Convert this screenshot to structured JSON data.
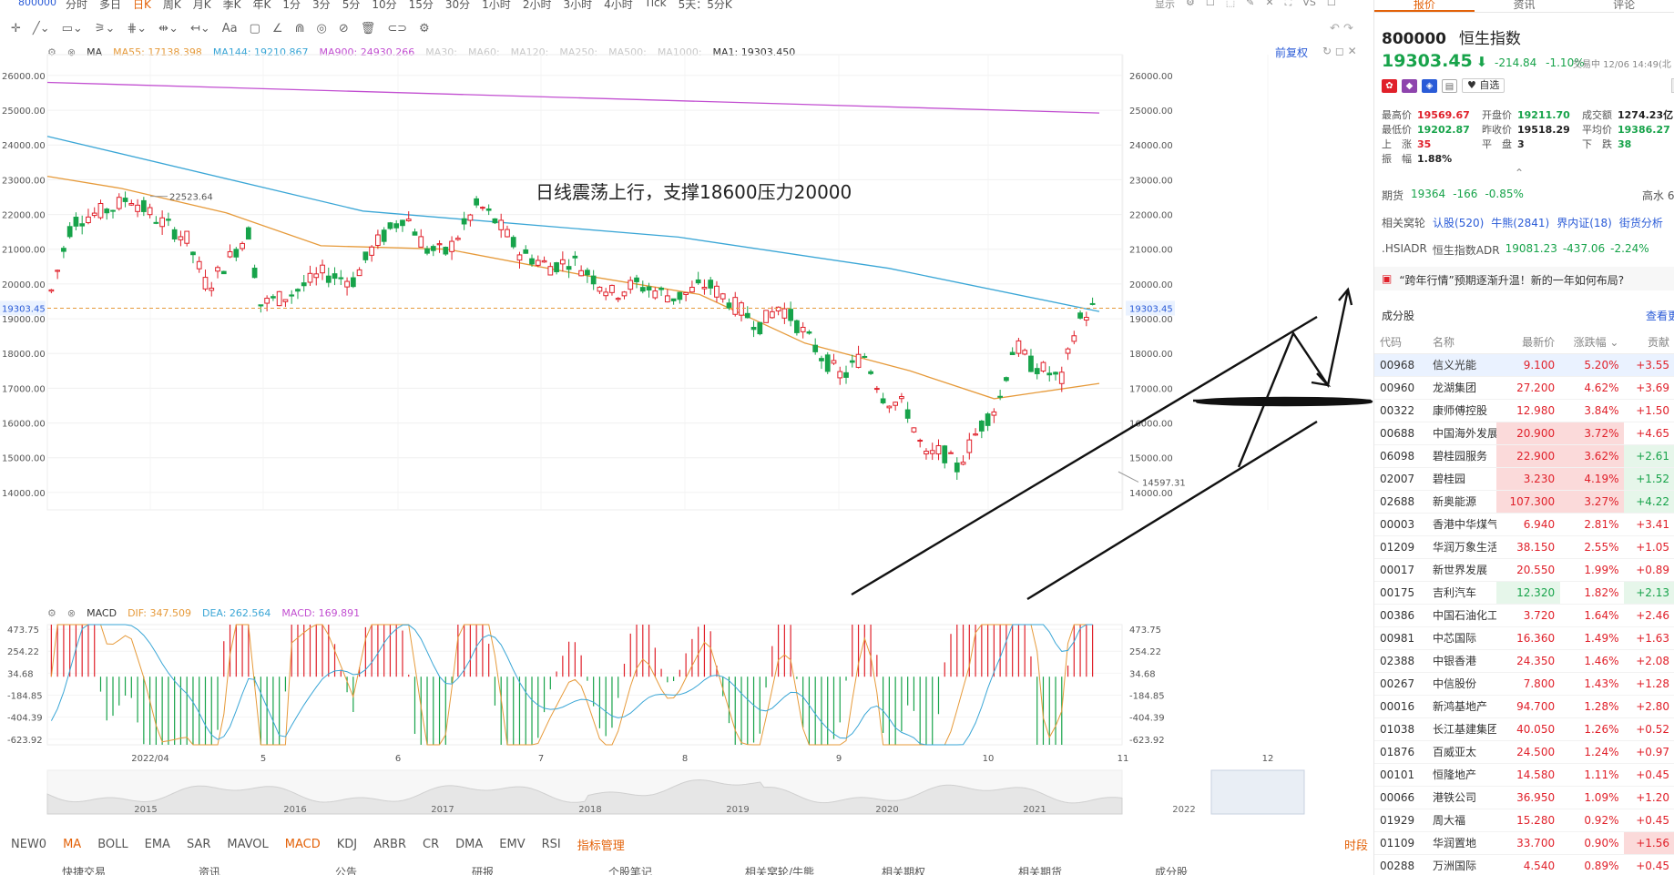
{
  "toolbar": {
    "code": "800000",
    "periods": [
      "分时",
      "多日",
      "日K",
      "周K",
      "月K",
      "季K",
      "年K",
      "1分",
      "3分",
      "5分",
      "10分",
      "15分",
      "30分",
      "1小时",
      "2小时",
      "3小时",
      "4小时",
      "Tick",
      "5天：5分K"
    ],
    "active_period": "日K",
    "right": [
      "显示",
      "⚙",
      "☐",
      "⬚",
      "✎",
      "✕",
      "⛶",
      "VS",
      "☐"
    ]
  },
  "legend_main": {
    "label": "MA",
    "ma55": "MA55: 17138.398",
    "ma144": "MA144: 19210.867",
    "ma900": "MA900: 24930.266",
    "inactive": [
      "MA30:",
      "MA60:",
      "MA120:",
      "MA250:",
      "MA500:",
      "MA1000:"
    ],
    "ma1": "MA1: 19303.450",
    "restore": "前复权"
  },
  "legend_macd": {
    "label": "MACD",
    "dif": "DIF: 347.509",
    "dea": "DEA: 262.564",
    "macd": "MACD: 169.891"
  },
  "colors": {
    "up": "#e0202a",
    "down": "#17a34a",
    "ma55": "#e69a3a",
    "ma144": "#3aa6d6",
    "ma900": "#c24fd1",
    "accent": "#e36209",
    "link": "#2a5bd7"
  },
  "chart_data": {
    "type": "candlestick",
    "title": "",
    "annotation": "日线震荡上行，支撑18600压力20000",
    "y_ticks": [
      "26000.00",
      "25000.00",
      "24000.00",
      "23000.00",
      "22000.00",
      "21000.00",
      "20000.00",
      "19000.00",
      "18000.00",
      "17000.00",
      "16000.00",
      "15000.00",
      "14000.00"
    ],
    "ylim": [
      13500,
      26600
    ],
    "current_price": "19303.45",
    "current_price_right": "19303.45",
    "high_label": "22523.64",
    "low_label": "14597.31",
    "x_labels": [
      "2022/04",
      "5",
      "6",
      "7",
      "8",
      "9",
      "10",
      "11",
      "12"
    ],
    "series": [
      {
        "name": "MA900",
        "points": [
          [
            0,
            25800
          ],
          [
            1,
            24920
          ]
        ]
      },
      {
        "name": "MA144",
        "points": [
          [
            0,
            24250
          ],
          [
            0.3,
            22100
          ],
          [
            0.6,
            21350
          ],
          [
            0.8,
            20450
          ],
          [
            1,
            19210
          ]
        ]
      },
      {
        "name": "MA55",
        "points": [
          [
            0,
            23100
          ],
          [
            0.07,
            22750
          ],
          [
            0.17,
            22050
          ],
          [
            0.26,
            21100
          ],
          [
            0.38,
            21000
          ],
          [
            0.52,
            20200
          ],
          [
            0.62,
            19700
          ],
          [
            0.72,
            18300
          ],
          [
            0.82,
            17500
          ],
          [
            0.9,
            16700
          ],
          [
            1,
            17140
          ]
        ]
      }
    ],
    "macd_ticks": [
      "473.75",
      "254.22",
      "34.68",
      "-184.85",
      "-404.39",
      "-623.92"
    ],
    "macd_ylim": [
      -680,
      520
    ],
    "macd_series": [
      {
        "name": "DIF",
        "color": "#e69a3a"
      },
      {
        "name": "DEA",
        "color": "#3aa6d6"
      }
    ]
  },
  "overview": {
    "years": [
      "2015",
      "2016",
      "2017",
      "2018",
      "2019",
      "2020",
      "2021",
      "2022"
    ]
  },
  "indicators": {
    "tabs": [
      "NEW0",
      "MA",
      "BOLL",
      "EMA",
      "SAR",
      "MAVOL",
      "MACD",
      "KDJ",
      "ARBR",
      "CR",
      "DMA",
      "EMV",
      "RSI"
    ],
    "active": [
      "MA",
      "MACD"
    ],
    "manager": "指标管理",
    "time_share": "时段"
  },
  "bottom_links": [
    "快捷交易",
    "资讯",
    "公告",
    "研报",
    "个股笔记",
    "相关窝轮/牛熊",
    "相关期权",
    "相关期货",
    "成分股"
  ],
  "panel": {
    "tabs": [
      "报价",
      "资讯",
      "评论"
    ],
    "active_tab": "报价",
    "code": "800000",
    "name": "恒生指数",
    "price": "19303.45",
    "change": "-214.84",
    "change_pct": "-1.10%",
    "trade_time": "交易中 12/06 14:49(北",
    "fav": "♥ 自选",
    "stats": [
      {
        "label": "最高价",
        "value": "19569.67",
        "color": "red"
      },
      {
        "label": "开盘价",
        "value": "19211.70",
        "color": "green"
      },
      {
        "label": "成交额",
        "value": "1274.23亿",
        "color": "dark"
      },
      {
        "label": "最低价",
        "value": "19202.87",
        "color": "green"
      },
      {
        "label": "昨收价",
        "value": "19518.29",
        "color": "dark"
      },
      {
        "label": "平均价",
        "value": "19386.27",
        "color": "green"
      },
      {
        "label": "上　涨",
        "value": "35",
        "color": "red"
      },
      {
        "label": "平　盘",
        "value": "3",
        "color": "dark"
      },
      {
        "label": "下　跌",
        "value": "38",
        "color": "green"
      },
      {
        "label": "振　幅",
        "value": "1.88%",
        "color": "dark"
      }
    ],
    "futures_label": "期货",
    "futures_price": "19364",
    "futures_change": "-166",
    "futures_pct": "-0.85%",
    "futures_right": "高水 6",
    "warrants_label": "相关窝轮",
    "warrants": [
      "认股(520)",
      "牛熊(2841)",
      "界内证(18)",
      "街货分析"
    ],
    "adr_code": ".HSIADR",
    "adr_name": "恒生指数ADR",
    "adr_price": "19081.23",
    "adr_change": "-437.06",
    "adr_pct": "-2.24%",
    "news": "“跨年行情”预期逐渐升温！新的一年如何布局?",
    "constituents_title": "成分股",
    "view_more": "查看更",
    "table_headers": [
      "代码",
      "名称",
      "最新价",
      "涨跌幅 ⌄",
      "贡献"
    ],
    "rows": [
      {
        "code": "00968",
        "name": "信义光能",
        "price": "9.100",
        "pct": "5.20%",
        "contrib": "+3.55",
        "sel": true
      },
      {
        "code": "00960",
        "name": "龙湖集团",
        "price": "27.200",
        "pct": "4.62%",
        "contrib": "+3.69"
      },
      {
        "code": "00322",
        "name": "康师傅控股",
        "price": "12.980",
        "pct": "3.84%",
        "contrib": "+1.50"
      },
      {
        "code": "00688",
        "name": "中国海外发展",
        "price": "20.900",
        "pct": "3.72%",
        "contrib": "+4.65",
        "hl": true
      },
      {
        "code": "06098",
        "name": "碧桂园服务",
        "price": "22.900",
        "pct": "3.62%",
        "contrib": "+2.61",
        "hl": true,
        "hlg": true
      },
      {
        "code": "02007",
        "name": "碧桂园",
        "price": "3.230",
        "pct": "4.19%",
        "contrib": "+1.52",
        "hl": true,
        "hlg": true
      },
      {
        "code": "02688",
        "name": "新奥能源",
        "price": "107.300",
        "pct": "3.27%",
        "contrib": "+4.22",
        "hl": true,
        "hlg": true
      },
      {
        "code": "00003",
        "name": "香港中华煤气",
        "price": "6.940",
        "pct": "2.81%",
        "contrib": "+3.41"
      },
      {
        "code": "01209",
        "name": "华润万象生活",
        "price": "38.150",
        "pct": "2.55%",
        "contrib": "+1.05"
      },
      {
        "code": "00017",
        "name": "新世界发展",
        "price": "20.550",
        "pct": "1.99%",
        "contrib": "+0.89"
      },
      {
        "code": "00175",
        "name": "吉利汽车",
        "price": "12.320",
        "pct": "1.82%",
        "contrib": "+2.13",
        "hlg": true,
        "hlgprice": true
      },
      {
        "code": "00386",
        "name": "中国石油化工",
        "price": "3.720",
        "pct": "1.64%",
        "contrib": "+2.46"
      },
      {
        "code": "00981",
        "name": "中芯国际",
        "price": "16.360",
        "pct": "1.49%",
        "contrib": "+1.63"
      },
      {
        "code": "02388",
        "name": "中银香港",
        "price": "24.350",
        "pct": "1.46%",
        "contrib": "+2.08"
      },
      {
        "code": "00267",
        "name": "中信股份",
        "price": "7.800",
        "pct": "1.43%",
        "contrib": "+1.28"
      },
      {
        "code": "00016",
        "name": "新鸿基地产",
        "price": "94.700",
        "pct": "1.28%",
        "contrib": "+2.80"
      },
      {
        "code": "01038",
        "name": "长江基建集团",
        "price": "40.050",
        "pct": "1.26%",
        "contrib": "+0.52"
      },
      {
        "code": "01876",
        "name": "百威亚太",
        "price": "24.500",
        "pct": "1.24%",
        "contrib": "+0.97"
      },
      {
        "code": "00101",
        "name": "恒隆地产",
        "price": "14.580",
        "pct": "1.11%",
        "contrib": "+0.45"
      },
      {
        "code": "00066",
        "name": "港铁公司",
        "price": "36.950",
        "pct": "1.09%",
        "contrib": "+1.20"
      },
      {
        "code": "01929",
        "name": "周大福",
        "price": "15.280",
        "pct": "0.92%",
        "contrib": "+0.45"
      },
      {
        "code": "01109",
        "name": "华润置地",
        "price": "33.700",
        "pct": "0.90%",
        "contrib": "+1.56",
        "hlcontrib": true
      },
      {
        "code": "00288",
        "name": "万洲国际",
        "price": "4.540",
        "pct": "0.89%",
        "contrib": "+0.45"
      }
    ]
  }
}
